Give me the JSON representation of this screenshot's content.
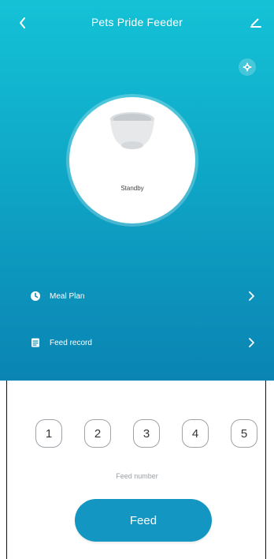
{
  "header": {
    "title": "Pets Pride Feeder"
  },
  "device": {
    "status": "Standby"
  },
  "menu": {
    "items": [
      {
        "label": "Meal Plan",
        "icon": "clock-icon"
      },
      {
        "label": "Feed record",
        "icon": "record-icon"
      }
    ]
  },
  "feed": {
    "numbers": [
      "1",
      "2",
      "3",
      "4",
      "5"
    ],
    "label": "Feed number",
    "button_label": "Feed"
  },
  "colors": {
    "top_gradient_start": "#14c2d6",
    "top_gradient_mid": "#0fa9c8",
    "top_gradient_end": "#0a84b3",
    "feed_button": "#1396c1"
  }
}
